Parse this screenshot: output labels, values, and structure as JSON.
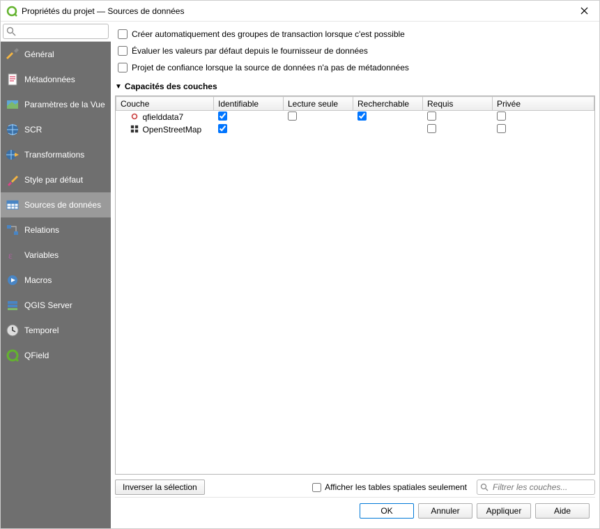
{
  "window": {
    "title": "Propriétés du projet — Sources de données"
  },
  "search": {
    "placeholder": ""
  },
  "sidebar": {
    "items": [
      {
        "label": "Général"
      },
      {
        "label": "Métadonnées"
      },
      {
        "label": "Paramètres de la Vue"
      },
      {
        "label": "SCR"
      },
      {
        "label": "Transformations"
      },
      {
        "label": "Style par défaut"
      },
      {
        "label": "Sources de données"
      },
      {
        "label": "Relations"
      },
      {
        "label": "Variables"
      },
      {
        "label": "Macros"
      },
      {
        "label": "QGIS Server"
      },
      {
        "label": "Temporel"
      },
      {
        "label": "QField"
      }
    ],
    "active_index": 6
  },
  "options": {
    "auto_groups": "Créer automatiquement des groupes de transaction lorsque c'est possible",
    "eval_defaults": "Évaluer les valeurs par défaut depuis le fournisseur de données",
    "trust_project": "Projet de confiance lorsque la source de données n'a pas de métadonnées"
  },
  "section": {
    "title": "Capacités des couches"
  },
  "table": {
    "headers": {
      "layer": "Couche",
      "identifiable": "Identifiable",
      "readonly": "Lecture seule",
      "searchable": "Recherchable",
      "required": "Requis",
      "private": "Privée"
    },
    "rows": [
      {
        "name": "qfielddata7",
        "identifiable": true,
        "readonly": false,
        "searchable": true,
        "required": false,
        "private": false
      },
      {
        "name": "OpenStreetMap",
        "identifiable": true,
        "readonly": false,
        "searchable": false,
        "required": false,
        "private": false
      }
    ]
  },
  "bottom": {
    "invert": "Inverser la sélection",
    "spatial_only": "Afficher les tables spatiales seulement",
    "filter_placeholder": "Filtrer les couches..."
  },
  "buttons": {
    "ok": "OK",
    "cancel": "Annuler",
    "apply": "Appliquer",
    "help": "Aide"
  }
}
